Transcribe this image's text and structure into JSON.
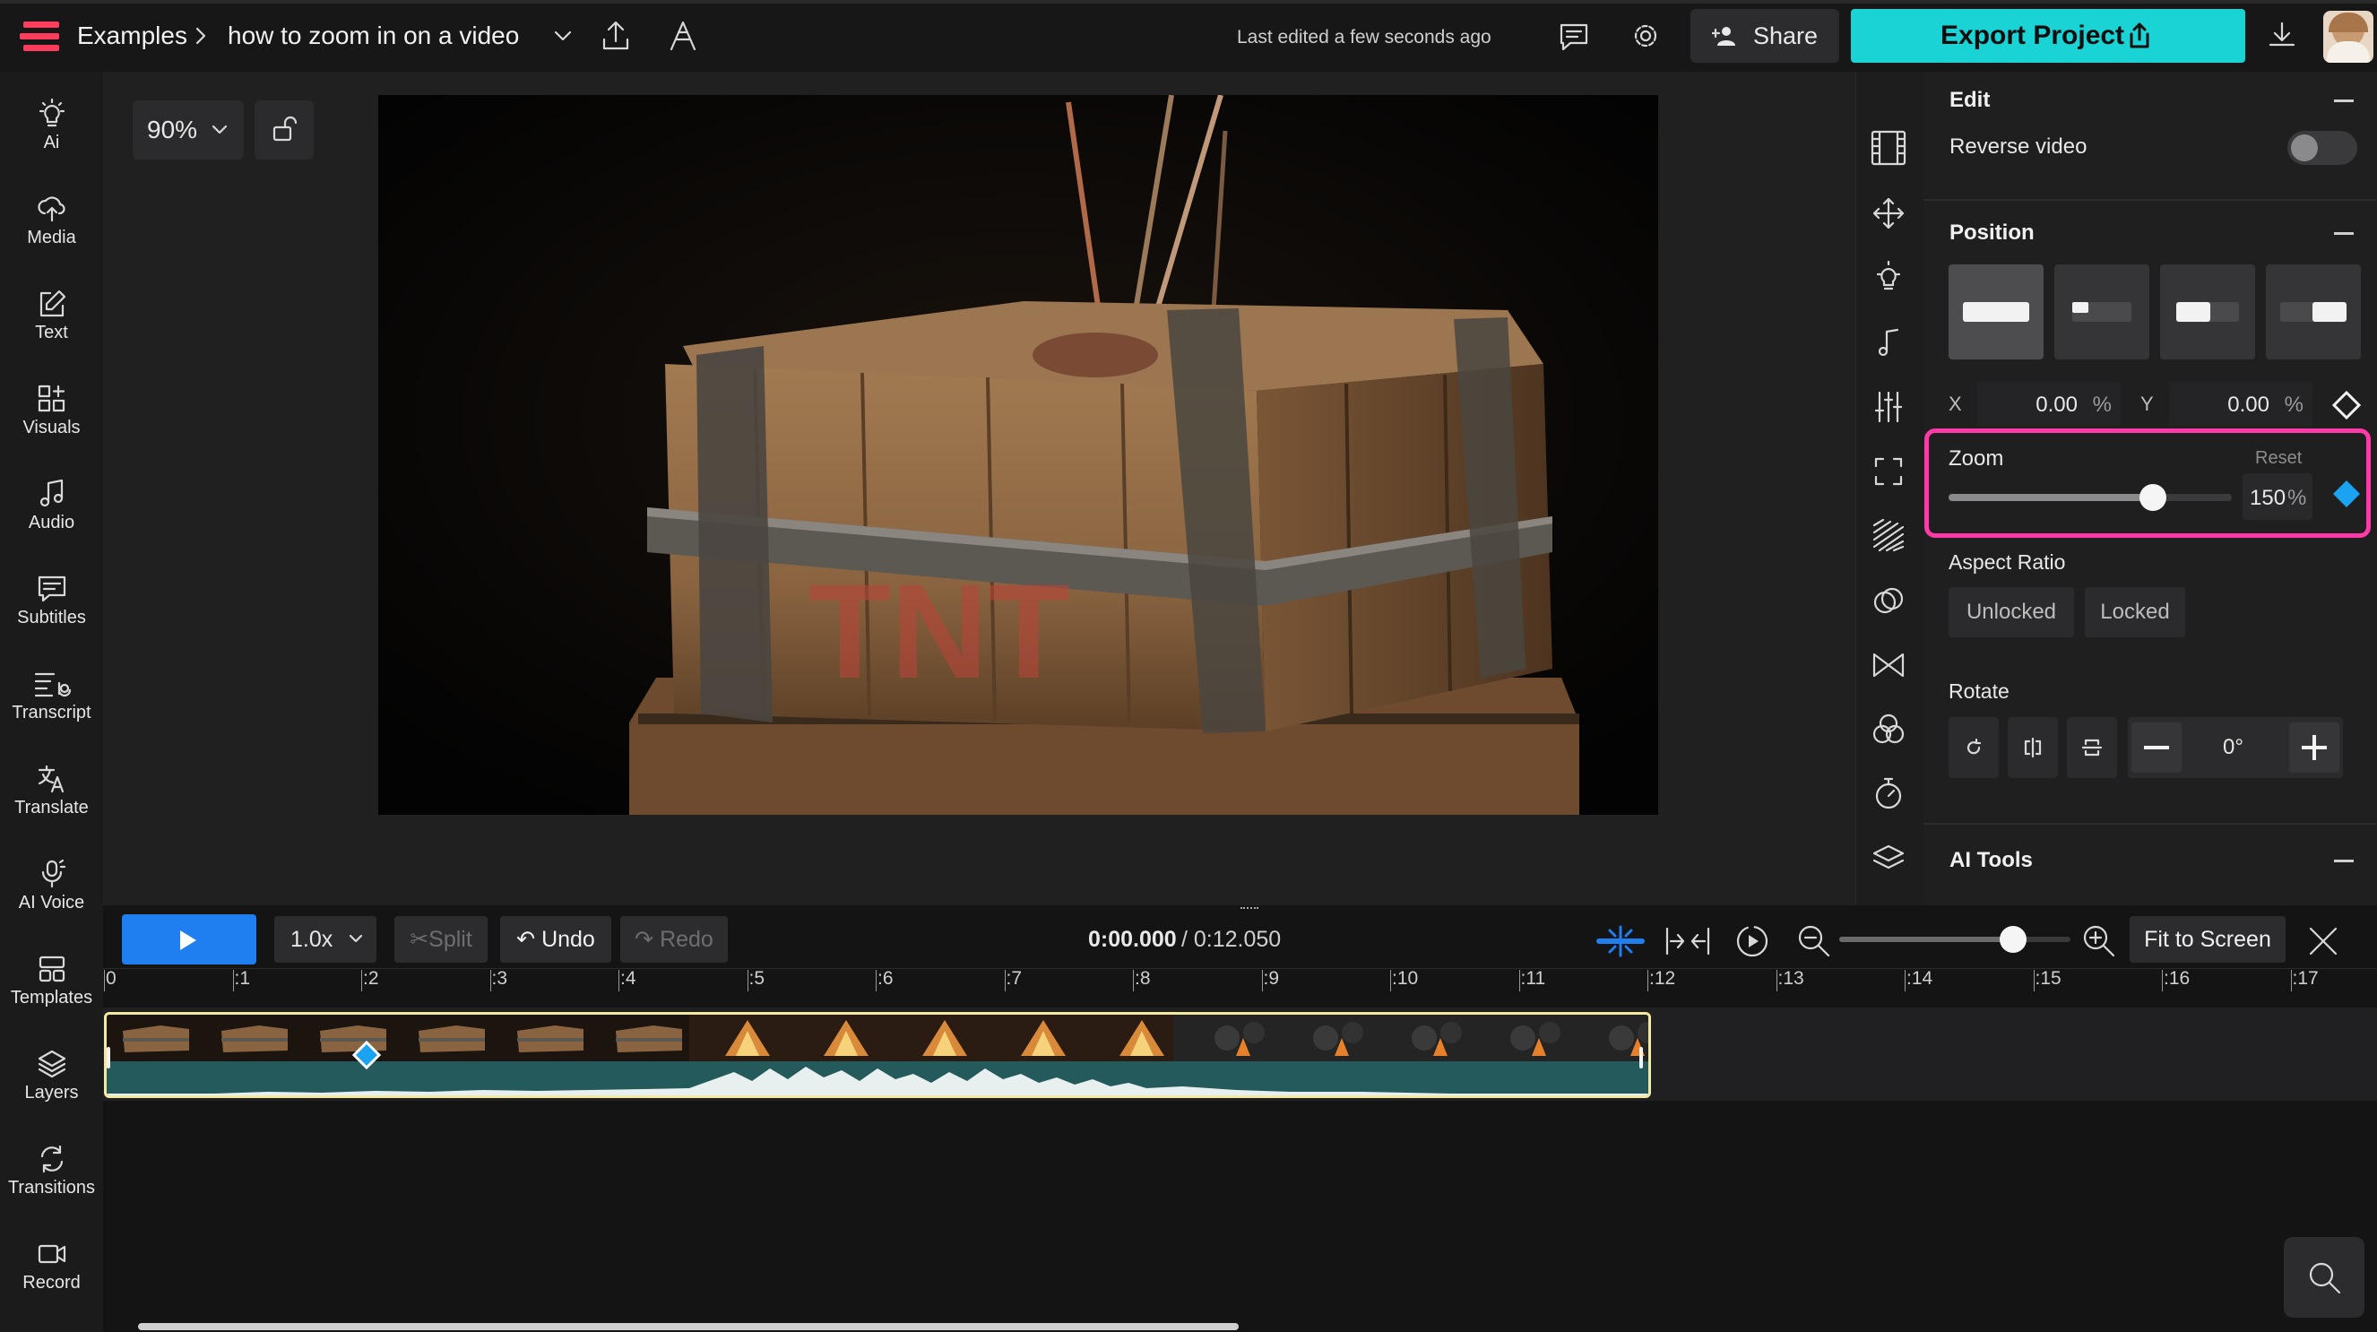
{
  "topbar": {
    "breadcrumb_root": "Examples",
    "project_name": "how to zoom in on a video",
    "last_edited": "Last edited a few seconds ago",
    "share_label": "Share",
    "export_label": "Export Project"
  },
  "sidebar": {
    "items": [
      {
        "label": "Ai",
        "icon": "bulb-icon"
      },
      {
        "label": "Media",
        "icon": "upload-icon"
      },
      {
        "label": "Text",
        "icon": "edit-icon"
      },
      {
        "label": "Visuals",
        "icon": "shapes-icon"
      },
      {
        "label": "Audio",
        "icon": "music-icon"
      },
      {
        "label": "Subtitles",
        "icon": "subtitles-icon"
      },
      {
        "label": "Transcript",
        "icon": "transcript-icon"
      },
      {
        "label": "Translate",
        "icon": "translate-icon"
      },
      {
        "label": "AI Voice",
        "icon": "mic-icon"
      },
      {
        "label": "Templates",
        "icon": "templates-icon"
      },
      {
        "label": "Layers",
        "icon": "layers-icon"
      },
      {
        "label": "Transitions",
        "icon": "transitions-icon"
      },
      {
        "label": "Record",
        "icon": "record-icon"
      }
    ]
  },
  "canvas": {
    "zoom_level": "90%"
  },
  "panel": {
    "edit": {
      "title": "Edit",
      "reverse_label": "Reverse video",
      "reverse_on": false
    },
    "position": {
      "title": "Position",
      "x_label": "X",
      "x_value": "0.00",
      "y_label": "Y",
      "y_value": "0.00",
      "unit": "%"
    },
    "zoom": {
      "title": "Zoom",
      "reset_label": "Reset",
      "value": "150",
      "unit": "%",
      "level": 0.72,
      "highlight_color": "#ff3aa8",
      "keyframe_color": "#1aa3f0"
    },
    "aspect": {
      "title": "Aspect Ratio",
      "unlocked": "Unlocked",
      "locked": "Locked"
    },
    "rotate": {
      "title": "Rotate",
      "value": "0°"
    },
    "ai_tools": {
      "title": "AI Tools"
    }
  },
  "timeline": {
    "speed": "1.0x",
    "split_label": "Split",
    "undo_label": "Undo",
    "redo_label": "Redo",
    "current_time": "0:00.000",
    "total_time": "/ 0:12.050",
    "fit_label": "Fit to Screen",
    "ticks": [
      "0",
      ":1",
      ":2",
      ":3",
      ":4",
      ":5",
      ":6",
      ":7",
      ":8",
      ":9",
      ":10",
      ":11",
      ":12",
      ":13",
      ":14",
      ":15",
      ":16",
      ":17"
    ],
    "timeline_zoom_level": 0.75,
    "accent": "#1f7ff0",
    "clip_border": "#f3e9a0"
  }
}
